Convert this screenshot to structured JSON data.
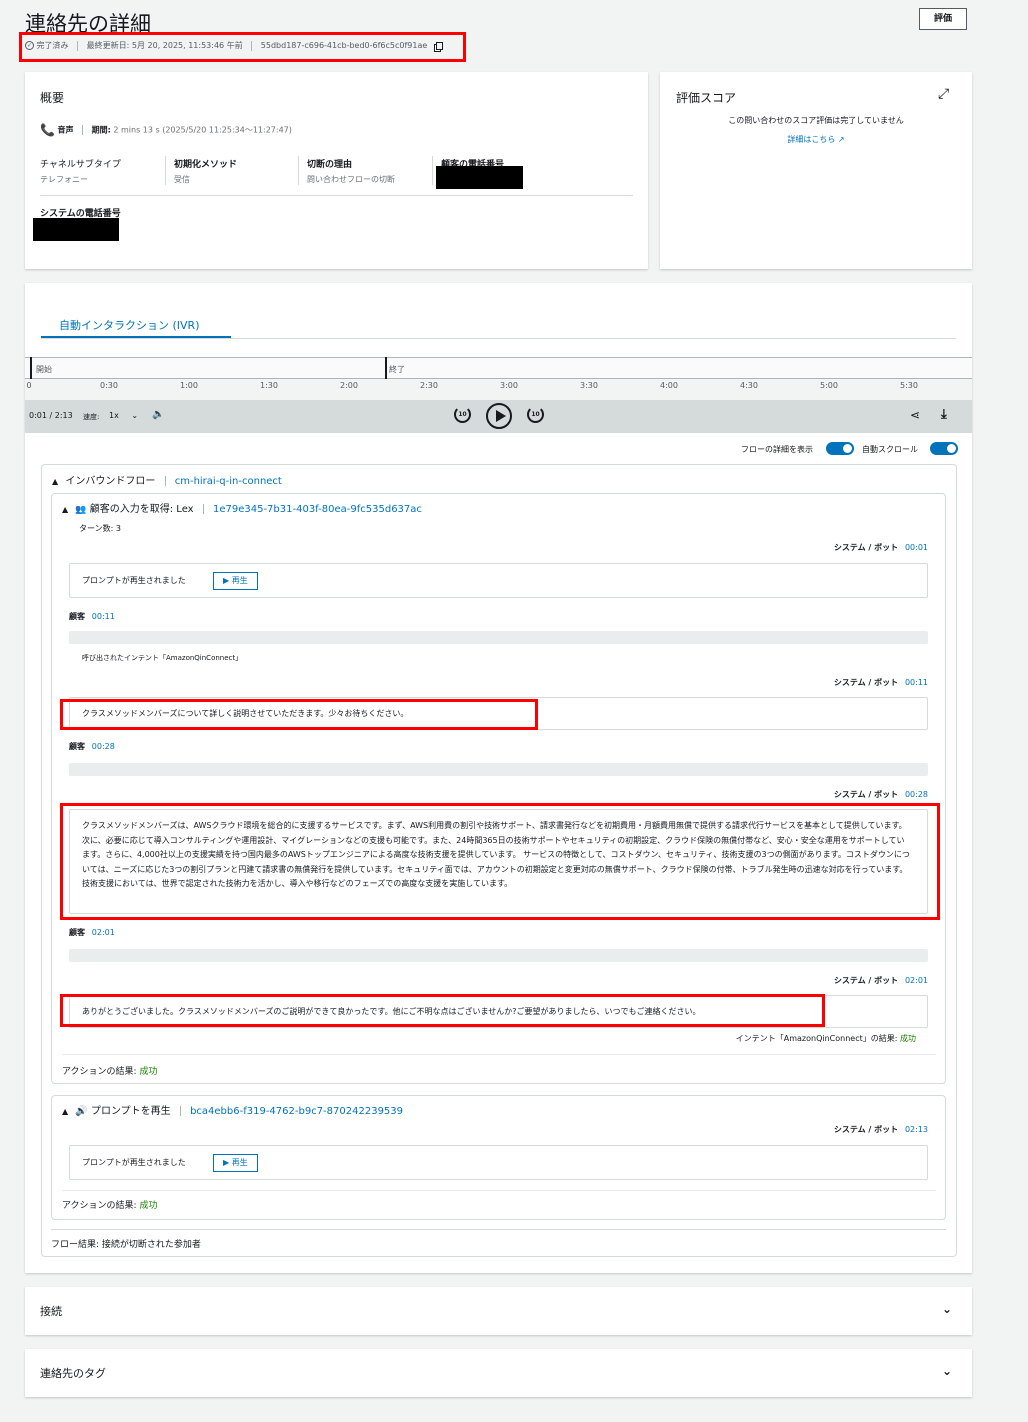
{
  "header": {
    "title": "連絡先の詳細",
    "status": "完了済み",
    "last_updated": "最終更新日: 5月 20, 2025, 11:53:46 午前",
    "contact_id": "55dbd187-c696-41cb-bed0-6f6c5c0f91ae",
    "evaluate_button": "評価"
  },
  "overview": {
    "title": "概要",
    "channel": "音声",
    "duration_label": "期間:",
    "duration_value": "2 mins 13 s (2025/5/20 11:25:34〜11:27:47)",
    "fields": [
      {
        "label": "チャネルサブタイプ",
        "value": "テレフォニー"
      },
      {
        "label": "初期化メソッド",
        "value": "受信"
      },
      {
        "label": "切断の理由",
        "value": "問い合わせフローの切断"
      },
      {
        "label": "顧客の電話番号",
        "value": ""
      }
    ],
    "system_phone_label": "システムの電話番号"
  },
  "score": {
    "title": "評価スコア",
    "message": "この問い合わせのスコア評価は完了していません",
    "link": "詳細はこちら"
  },
  "ivr": {
    "tab": "自動インタラクション (IVR)",
    "timeline": {
      "start_label": "開始",
      "end_label": "終了",
      "ticks": [
        "0",
        "0:30",
        "1:00",
        "1:30",
        "2:00",
        "2:30",
        "3:00",
        "3:30",
        "4:00",
        "4:30",
        "5:00",
        "5:30"
      ]
    },
    "player": {
      "time": "0:01 / 2:13",
      "speed_label": "速度:",
      "speed_value": "1x",
      "rewind": "10",
      "forward": "10"
    },
    "toggles": {
      "flow_details": "フローの詳細を表示",
      "autoscroll": "自動スクロール"
    },
    "inbound_flow": {
      "label": "インバウンドフロー",
      "name": "cm-hirai-q-in-connect",
      "flow_result": "フロー結果: 接続が切断された参加者"
    },
    "lex_block": {
      "title": "顧客の入力を取得: Lex",
      "id": "1e79e345-7b31-403f-80ea-9fc535d637ac",
      "turns": "ターン数: 3",
      "system_label": "システム / ボット",
      "customer_label": "顧客",
      "prompt_text": "プロンプトが再生されました",
      "play_label": "▶ 再生",
      "intent_called": "呼び出されたインテント「AmazonQinConnect」",
      "t_sys1": "00:01",
      "t_cust1": "00:11",
      "t_sys2": "00:11",
      "msg2": "クラスメソッドメンバーズについて詳しく説明させていただきます。少々お待ちください。",
      "t_cust2": "00:28",
      "t_sys3": "00:28",
      "msg3": "クラスメソッドメンバーズは、AWSクラウド環境を総合的に支援するサービスです。まず、AWS利用費の割引や技術サポート、請求書発行などを初期費用・月額費用無償で提供する請求代行サービスを基本として提供しています。次に、必要に応じて導入コンサルティングや運用設計、マイグレーションなどの支援も可能です。また、24時間365日の技術サポートやセキュリティの初期設定、クラウド保険の無償付帯など、安心・安全な運用をサポートしています。さらに、4,000社以上の支援実績を持つ国内最多のAWSトップエンジニアによる高度な技術支援を提供しています。 サービスの特徴として、コストダウン、セキュリティ、技術支援の3つの側面があります。コストダウンについては、ニーズに応じた3つの割引プランと円建て請求書の無償発行を提供しています。セキュリティ面では、アカウントの初期設定と変更対応の無償サポート、クラウド保険の付帯、トラブル発生時の迅速な対応を行っています。技術支援においては、世界で認定された技術力を活かし、導入や移行などのフェーズでの高度な支援を実施しています。",
      "t_cust3": "02:01",
      "t_sys4": "02:01",
      "msg4": "ありがとうございました。クラスメソッドメンバーズのご説明ができて良かったです。他にご不明な点はございませんか?ご要望がありましたら、いつでもご連絡ください。",
      "intent_result_label": "インテント「AmazonQinConnect」の結果:",
      "intent_result_value": "成功",
      "action_result_label": "アクションの結果:",
      "action_result_value": "成功"
    },
    "prompt_block": {
      "title": "プロンプトを再生",
      "id": "bca4ebb6-f319-4762-b9c7-870242239539",
      "system_label": "システム / ボット",
      "time": "02:13",
      "prompt_text": "プロンプトが再生されました",
      "play_label": "▶ 再生",
      "action_result_label": "アクションの結果:",
      "action_result_value": "成功"
    }
  },
  "sections": {
    "connection": "接続",
    "tags": "連絡先のタグ"
  }
}
